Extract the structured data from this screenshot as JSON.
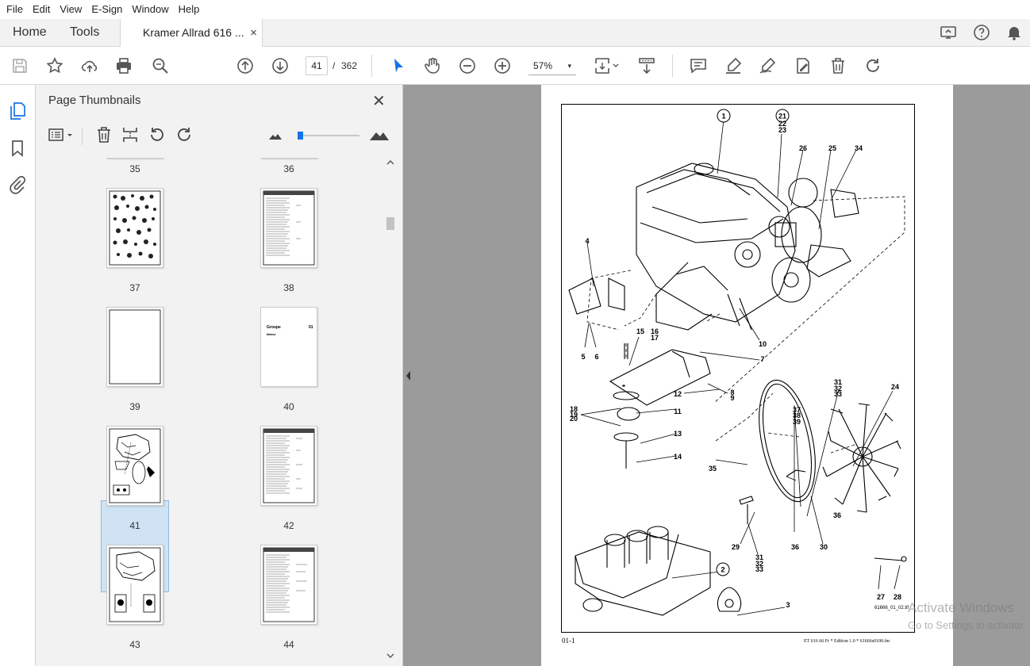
{
  "menu": {
    "items": [
      "File",
      "Edit",
      "View",
      "E-Sign",
      "Window",
      "Help"
    ]
  },
  "tabs": {
    "home": "Home",
    "tools": "Tools",
    "document": "Kramer Allrad 616 ...",
    "close": "×"
  },
  "toolbar": {
    "current_page": "41",
    "slash": "/",
    "total_pages": "362",
    "zoom": "57%",
    "zoom_caret": "▾"
  },
  "panel": {
    "title": "Page Thumbnails",
    "close": "✕"
  },
  "thumbnails": [
    {
      "label": "35",
      "page": 35
    },
    {
      "label": "36",
      "page": 36
    },
    {
      "label": "37",
      "page": 37
    },
    {
      "label": "38",
      "page": 38
    },
    {
      "label": "39",
      "page": 39
    },
    {
      "label": "40",
      "page": 40
    },
    {
      "label": "41",
      "page": 41,
      "selected": true
    },
    {
      "label": "42",
      "page": 42
    },
    {
      "label": "43",
      "page": 43
    },
    {
      "label": "44",
      "page": 44
    }
  ],
  "thumb40_text": {
    "left": "Groupe",
    "right": "01",
    "sub": "Moteur"
  },
  "document": {
    "callouts": [
      "1",
      "21",
      "22",
      "23",
      "26",
      "25",
      "34",
      "4",
      "5",
      "6",
      "15",
      "16",
      "17",
      "10",
      "7",
      "12",
      "8",
      "9",
      "11",
      "18",
      "19",
      "20",
      "13",
      "14",
      "31",
      "32",
      "33",
      "24",
      "37",
      "38",
      "39",
      "35",
      "36",
      "29",
      "36",
      "30",
      "31",
      "32",
      "33",
      "2",
      "27",
      "28",
      "3"
    ],
    "footer_left": "01-1",
    "footer_right": "ET 616 66 Fr * Edition 1.0 * 61666s0100.fm",
    "drawing_ref": "61666_01_02.tif"
  },
  "watermark": {
    "line1": "Activate Windows",
    "line2": "Go to Settings to activate"
  },
  "colors": {
    "accent": "#1473e6",
    "panel_bg": "#f2f2f2",
    "doc_bg": "#9b9b9b"
  }
}
